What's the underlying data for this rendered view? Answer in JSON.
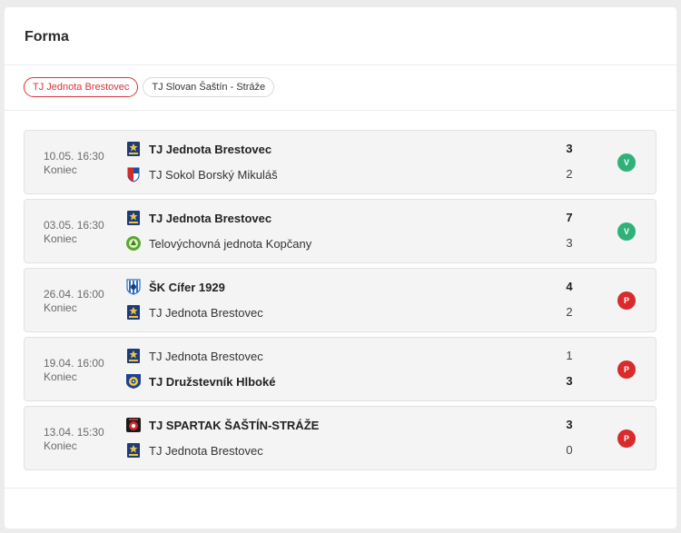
{
  "title": "Forma",
  "tabs": [
    {
      "label": "TJ Jednota Brestovec",
      "active": true
    },
    {
      "label": "TJ Slovan Šaštín - Stráže",
      "active": false
    }
  ],
  "colors": {
    "win": "#2fb27a",
    "loss": "#d92b2b",
    "accent": "#d9343a"
  },
  "matches": [
    {
      "date": "10.05. 16:30",
      "status": "Koniec",
      "home": {
        "name": "TJ Jednota Brestovec",
        "score": "3",
        "winner": true,
        "crest": "brestovec-crest"
      },
      "away": {
        "name": "TJ Sokol Borský Mikuláš",
        "score": "2",
        "winner": false,
        "crest": "borsky-mikulas-crest"
      },
      "result": "V"
    },
    {
      "date": "03.05. 16:30",
      "status": "Koniec",
      "home": {
        "name": "TJ Jednota Brestovec",
        "score": "7",
        "winner": true,
        "crest": "brestovec-crest"
      },
      "away": {
        "name": "Telovýchovná jednota Kopčany",
        "score": "3",
        "winner": false,
        "crest": "kopcany-crest"
      },
      "result": "V"
    },
    {
      "date": "26.04. 16:00",
      "status": "Koniec",
      "home": {
        "name": "ŠK Cífer 1929",
        "score": "4",
        "winner": true,
        "crest": "cifer-crest"
      },
      "away": {
        "name": "TJ Jednota Brestovec",
        "score": "2",
        "winner": false,
        "crest": "brestovec-crest"
      },
      "result": "P"
    },
    {
      "date": "19.04. 16:00",
      "status": "Koniec",
      "home": {
        "name": "TJ Jednota Brestovec",
        "score": "1",
        "winner": false,
        "crest": "brestovec-crest"
      },
      "away": {
        "name": "TJ Družstevník Hlboké",
        "score": "3",
        "winner": true,
        "crest": "hlboke-crest"
      },
      "result": "P"
    },
    {
      "date": "13.04. 15:30",
      "status": "Koniec",
      "home": {
        "name": "TJ SPARTAK ŠAŠTÍN-STRÁŽE",
        "score": "3",
        "winner": true,
        "crest": "sastin-straze-crest"
      },
      "away": {
        "name": "TJ Jednota Brestovec",
        "score": "0",
        "winner": false,
        "crest": "brestovec-crest"
      },
      "result": "P"
    }
  ]
}
